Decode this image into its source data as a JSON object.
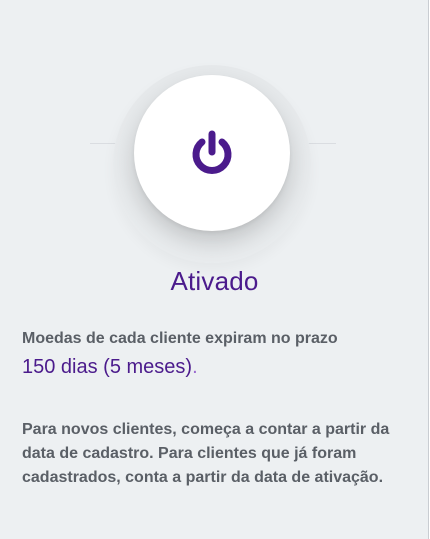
{
  "status": {
    "title": "Ativado",
    "icon": "power-icon",
    "accent_color": "#4b1b8c"
  },
  "expiration": {
    "description": "Moedas de cada cliente expiram no prazo",
    "value": "150 dias (5 meses)",
    "suffix": "."
  },
  "info": {
    "text": "Para novos clientes, começa a contar a partir da data de cadastro. Para clientes que já foram cadastrados, conta a partir da data de ativação."
  }
}
